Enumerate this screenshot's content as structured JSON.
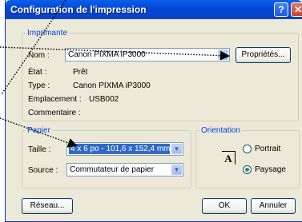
{
  "window": {
    "title": "Configuration de l'impression",
    "help_icon": "question-icon",
    "close_icon": "close-icon"
  },
  "printer": {
    "group_label": "Imprimante",
    "name_label": "Nom :",
    "name_value": "Canon PIXMA iP3000",
    "properties_button": "Propriétés...",
    "status_label": "État :",
    "status_value": "Prêt",
    "type_label": "Type :",
    "type_value": "Canon PIXMA iP3000",
    "location_label": "Emplacement :",
    "location_value": "USB002",
    "comment_label": "Commentaire :"
  },
  "paper": {
    "group_label": "Papier",
    "size_label": "Taille :",
    "size_value": "4 x 6 po - 101,6 x 152,4 mm",
    "source_label": "Source :",
    "source_value": "Commutateur de papier"
  },
  "orientation": {
    "group_label": "Orientation",
    "portrait_label": "Portrait",
    "landscape_label": "Paysage",
    "selected": "Paysage",
    "icon_letter": "A"
  },
  "footer": {
    "network_button": "Réseau...",
    "ok_button": "OK",
    "cancel_button": "Annuler"
  },
  "colors": {
    "titlebar": "#0348d6",
    "dialog_bg": "#ece9d8",
    "group_label": "#0046d5",
    "selection": "#316ac5"
  }
}
